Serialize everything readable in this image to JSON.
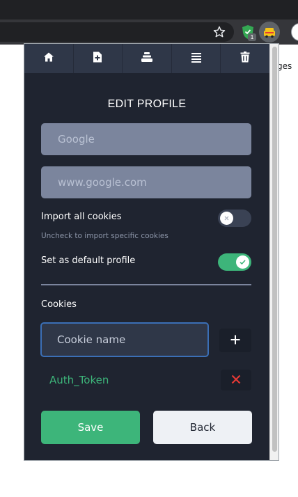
{
  "colors": {
    "accent_green": "#3db57a",
    "panel_bg": "#1f2430",
    "nav_bg": "#2f3748",
    "input_bg": "#7b859d",
    "focus_blue": "#3b6fb6",
    "danger_red": "#e53935"
  },
  "browser": {
    "toolbar_icons": [
      "star-icon",
      "shield-extension-icon",
      "cookie-extension-icon"
    ],
    "extension_badge": "1",
    "page_text_fragment": "ges"
  },
  "nav": {
    "items": [
      {
        "icon": "home-icon"
      },
      {
        "icon": "new-file-icon"
      },
      {
        "icon": "stack-icon"
      },
      {
        "icon": "list-icon"
      },
      {
        "icon": "trash-icon"
      }
    ]
  },
  "form": {
    "title": "EDIT PROFILE",
    "name_placeholder": "Google",
    "domain_placeholder": "www.google.com",
    "import_all_label": "Import all cookies",
    "import_all_hint": "Uncheck to import specific cookies",
    "import_all_enabled": false,
    "default_label": "Set as default profile",
    "default_enabled": true,
    "cookies_label": "Cookies",
    "cookie_name_placeholder": "Cookie name",
    "add_icon": "plus-icon",
    "cookies": [
      {
        "name": "Auth_Token",
        "remove_icon": "close-icon"
      }
    ],
    "save_label": "Save",
    "back_label": "Back"
  }
}
